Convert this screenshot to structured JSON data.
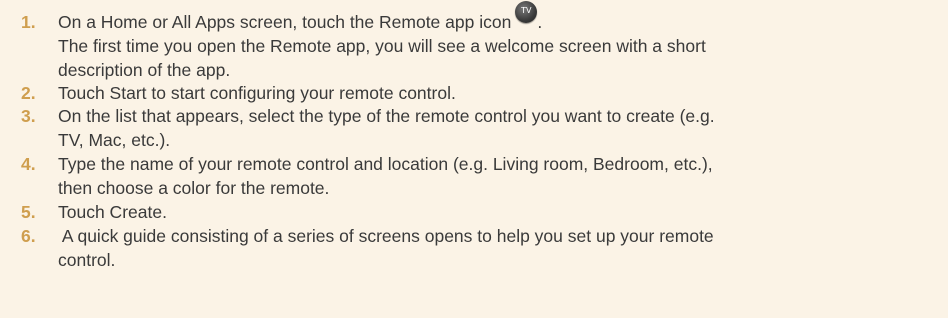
{
  "steps": [
    {
      "number": "1.",
      "lines": [
        "On a Home or All Apps screen, touch the Remote app icon",
        "The first time you open the Remote app, you will see a welcome screen with a short",
        "description of the app."
      ],
      "icon_name": "remote-app-tv-icon",
      "icon_label": "TV",
      "trailing": "."
    },
    {
      "number": "2.",
      "lines": [
        "Touch Start to start configuring your remote control."
      ]
    },
    {
      "number": "3.",
      "lines": [
        "On the list that appears, select the type of the remote control you want to create (e.g.",
        "TV, Mac, etc.)."
      ]
    },
    {
      "number": "4.",
      "lines": [
        "Type the name of your remote control and location (e.g. Living room, Bedroom, etc.),",
        "then choose a color for the remote."
      ]
    },
    {
      "number": "5.",
      "lines": [
        "Touch Create."
      ]
    },
    {
      "number": "6.",
      "lines": [
        " A quick guide consisting of a series of screens opens to help you set up your remote",
        "control."
      ]
    }
  ],
  "colors": {
    "background": "#fbf3e6",
    "number": "#cf9e4e",
    "text": "#3a3a3a"
  }
}
